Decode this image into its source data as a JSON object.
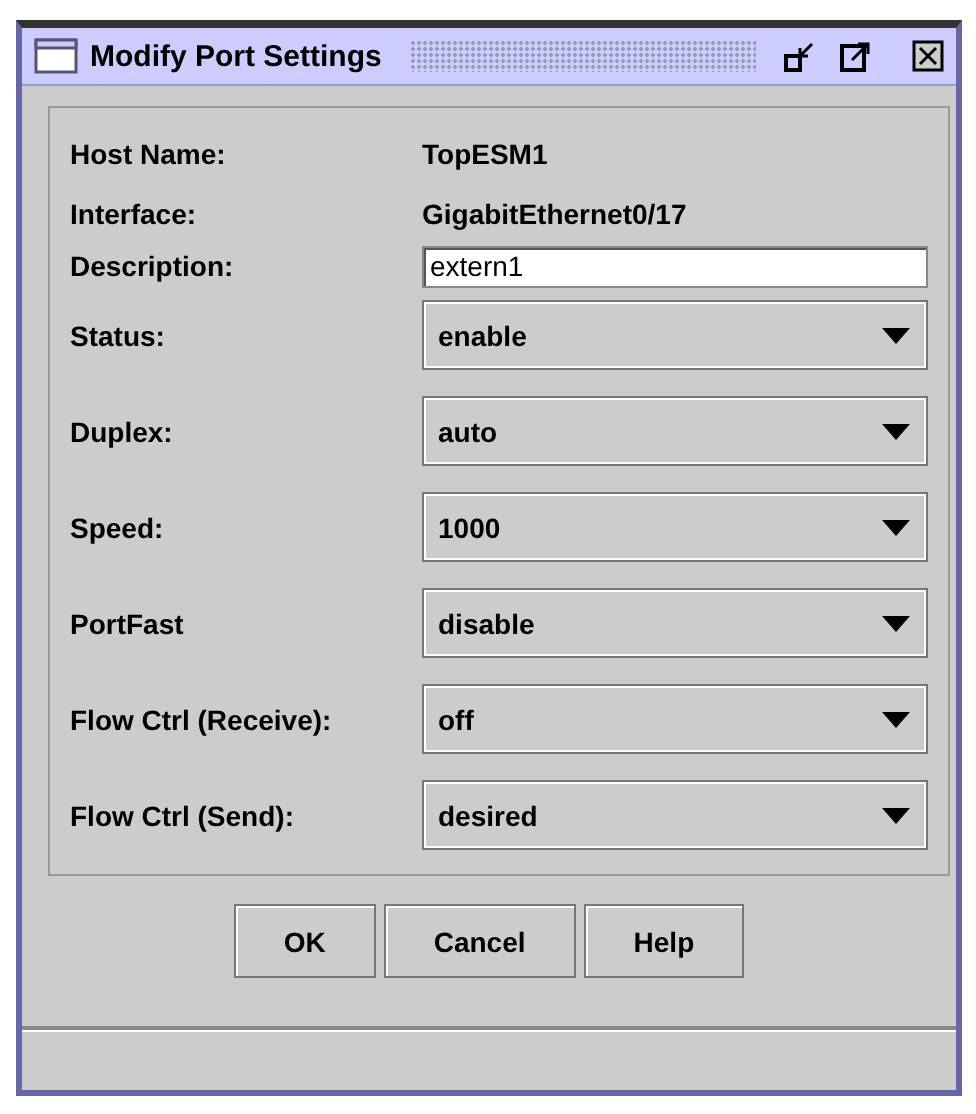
{
  "window": {
    "title": "Modify Port Settings"
  },
  "fields": [
    {
      "label": "Host Name:",
      "kind": "text",
      "value": "TopESM1"
    },
    {
      "label": "Interface:",
      "kind": "text",
      "value": "GigabitEthernet0/17"
    },
    {
      "label": "Description:",
      "kind": "input",
      "value": "extern1"
    },
    {
      "label": "Status:",
      "kind": "combo",
      "value": "enable"
    },
    {
      "label": "Duplex:",
      "kind": "combo",
      "value": "auto"
    },
    {
      "label": "Speed:",
      "kind": "combo",
      "value": "1000"
    },
    {
      "label": "PortFast",
      "kind": "combo",
      "value": "disable"
    },
    {
      "label": "Flow Ctrl (Receive):",
      "kind": "combo",
      "value": "off"
    },
    {
      "label": "Flow Ctrl (Send):",
      "kind": "combo",
      "value": "desired"
    }
  ],
  "buttons": [
    "OK",
    "Cancel",
    "Help"
  ]
}
